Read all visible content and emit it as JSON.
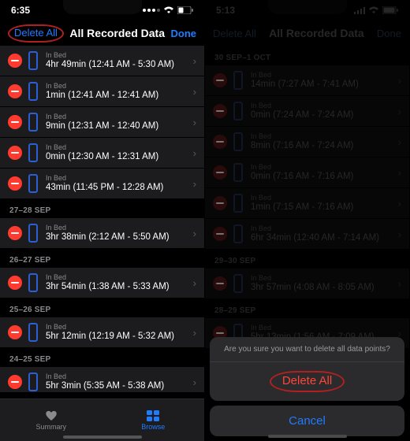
{
  "left": {
    "time": "6:35",
    "nav": {
      "delete_all": "Delete All",
      "title": "All Recorded Data",
      "done": "Done"
    },
    "in_bed_label": "In Bed",
    "group1": [
      "4hr 49min (12:41 AM - 5:30 AM)",
      "1min (12:41 AM - 12:41 AM)",
      "9min (12:31 AM - 12:40 AM)",
      "0min (12:30 AM - 12:31 AM)",
      "43min (11:45 PM - 12:28 AM)"
    ],
    "sections": [
      {
        "header": "27–28 SEP",
        "rows": [
          "3hr 38min (2:12 AM - 5:50 AM)"
        ]
      },
      {
        "header": "26–27 SEP",
        "rows": [
          "3hr 54min (1:38 AM - 5:33 AM)"
        ]
      },
      {
        "header": "25–26 SEP",
        "rows": [
          "5hr 12min (12:19 AM - 5:32 AM)"
        ]
      },
      {
        "header": "24–25 SEP",
        "rows": [
          "5hr 3min (5:35 AM - 5:38 AM)"
        ]
      }
    ],
    "tabs": {
      "summary": "Summary",
      "browse": "Browse"
    }
  },
  "right": {
    "time": "5:13",
    "nav": {
      "delete_all": "Delete All",
      "title": "All Recorded Data",
      "done": "Done"
    },
    "in_bed_label": "In Bed",
    "sections": [
      {
        "header": "30 SEP–1 OCT",
        "rows": [
          "14min (7:27 AM - 7:41 AM)",
          "0min (7:24 AM - 7:24 AM)",
          "8min (7:16 AM - 7:24 AM)",
          "0min (7:16 AM - 7:16 AM)",
          "1min (7:15 AM - 7:16 AM)",
          "6hr 34min (12:40 AM - 7:14 AM)"
        ]
      },
      {
        "header": "29–30 SEP",
        "rows": [
          "3hr 57min (4:08 AM - 8:05 AM)"
        ]
      },
      {
        "header": "28–29 SEP",
        "rows": [
          "5hr 13min (1:56 AM - 7:09 AM)"
        ]
      }
    ],
    "sheet": {
      "message": "Are you sure you want to delete all data points?",
      "delete": "Delete All",
      "cancel": "Cancel"
    }
  }
}
